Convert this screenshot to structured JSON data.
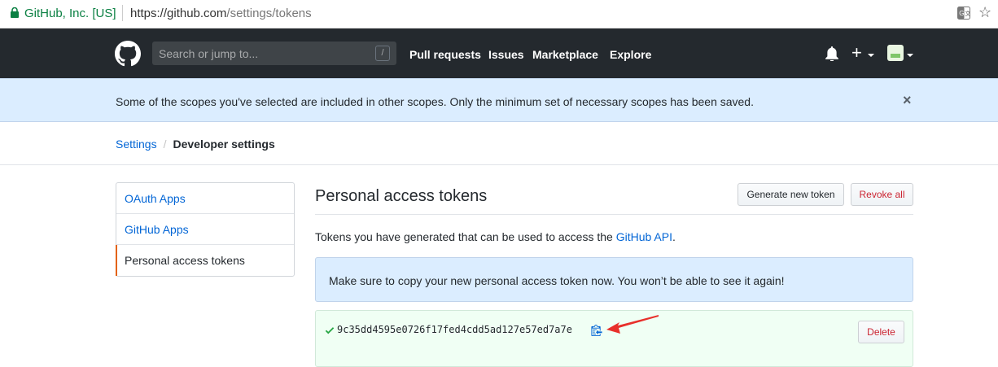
{
  "browser": {
    "site_identity": "GitHub, Inc. [US]",
    "url_host": "https://github.com",
    "url_path": "/settings/tokens"
  },
  "header": {
    "search_placeholder": "Search or jump to...",
    "search_shortcut": "/",
    "nav": [
      "Pull requests",
      "Issues",
      "Marketplace",
      "Explore"
    ],
    "plus": "+"
  },
  "flash": {
    "message": "Some of the scopes you've selected are included in other scopes. Only the minimum set of necessary scopes has been saved.",
    "close": "×"
  },
  "breadcrumb": {
    "parent": "Settings",
    "separator": "/",
    "current": "Developer settings"
  },
  "sidebar": {
    "items": [
      {
        "label": "OAuth Apps"
      },
      {
        "label": "GitHub Apps"
      },
      {
        "label": "Personal access tokens"
      }
    ]
  },
  "main": {
    "title": "Personal access tokens",
    "generate_label": "Generate new token",
    "revoke_label": "Revoke all",
    "description_prefix": "Tokens you have generated that can be used to access the ",
    "description_link": "GitHub API",
    "description_suffix": ".",
    "notice": "Make sure to copy your new personal access token now. You won’t be able to see it again!",
    "token": "9c35dd4595e0726f17fed4cdd5ad127e57ed7a7e",
    "delete_label": "Delete"
  },
  "colors": {
    "header_bg": "#24292e",
    "flash_bg": "#dbedff",
    "link": "#0366d6",
    "danger": "#cb2431",
    "selected_accent": "#e36209",
    "token_bg": "#f0fff4",
    "arrow": "#e8302b"
  }
}
